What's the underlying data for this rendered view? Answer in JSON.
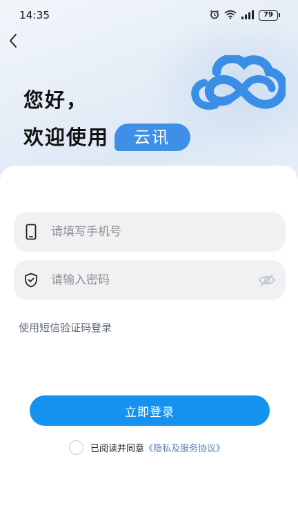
{
  "status_bar": {
    "time": "14:35",
    "battery_level": "79",
    "icons": [
      "alarm-icon",
      "wifi-icon",
      "signal-icon",
      "battery-icon"
    ]
  },
  "header": {
    "back_icon": "chevron-left-icon",
    "greeting_line1": "您好，",
    "greeting_line2": "欢迎使用",
    "brand_name": "云讯",
    "logo": "cloud-infinity-logo"
  },
  "form": {
    "phone": {
      "icon": "phone-icon",
      "placeholder": "请填写手机号",
      "value": ""
    },
    "password": {
      "icon": "shield-icon",
      "placeholder": "请输入密码",
      "value": "",
      "toggle_icon": "eye-off-icon"
    },
    "sms_login_link": "使用短信验证码登录",
    "login_button": "立即登录",
    "agreement": {
      "checked": false,
      "prefix": "已阅读并同意",
      "link": "《隐私及服务协议》"
    }
  },
  "colors": {
    "brand_blue": "#3f8fe6",
    "button_blue": "#1592f0",
    "field_bg": "#f1f1f3",
    "link_gray": "#5f6b7a"
  }
}
